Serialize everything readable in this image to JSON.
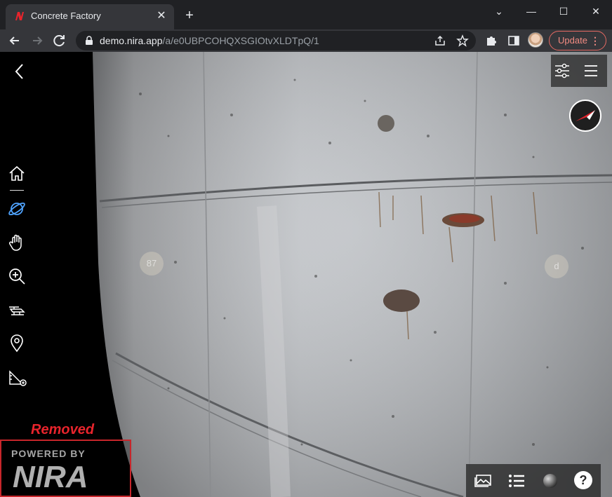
{
  "browser": {
    "tab": {
      "title": "Concrete Factory",
      "favicon": "nira-logo-icon",
      "close_glyph": "✕"
    },
    "new_tab_glyph": "+",
    "window_controls": {
      "dropdown": "⌄",
      "minimize": "—",
      "maximize": "☐",
      "close": "✕"
    },
    "address": {
      "host": "demo.nira.app",
      "path": "/a/e0UBPCOHQXSGIOtvXLDTpQ/1"
    },
    "update_button": {
      "label": "Update",
      "menu_glyph": "⋮"
    },
    "accent_color": "#f28b82"
  },
  "viewer": {
    "hotspots": [
      "87",
      "d"
    ],
    "left_toolbar_icons": [
      "back-chevron-icon",
      "home-icon",
      "orbit-icon",
      "pan-hand-icon",
      "zoom-icon",
      "fly-icon",
      "location-pin-icon",
      "measure-icon"
    ],
    "top_right_icons": [
      "settings-sliders-icon",
      "hamburger-menu-icon"
    ],
    "compass_icon": "compass-icon",
    "bottom_icons": [
      "gallery-icon",
      "list-icon",
      "sphere-icon",
      "help-icon"
    ],
    "help_glyph": "?"
  },
  "annotation": {
    "removed_label": "Removed",
    "watermark_line1": "POWERED BY",
    "watermark_logo": "NIRA",
    "annotation_color": "#e8242c"
  }
}
